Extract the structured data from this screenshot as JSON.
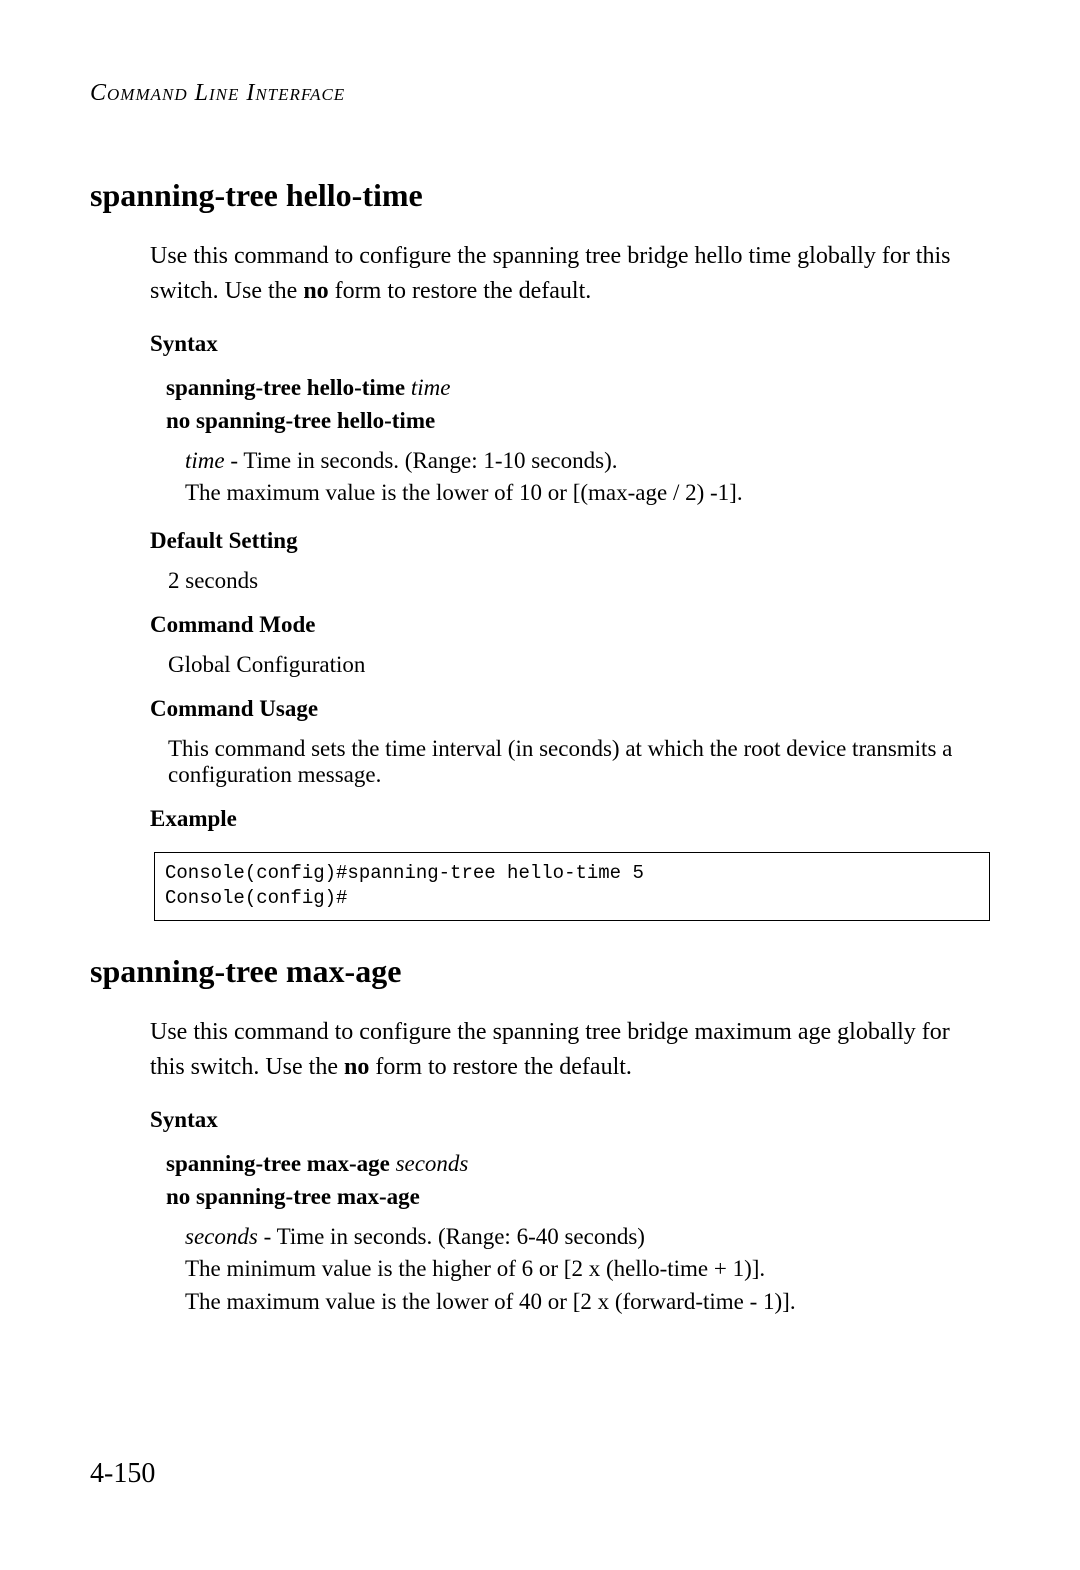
{
  "header": "Command Line Interface",
  "section1": {
    "title": "spanning-tree hello-time",
    "desc_pre": "Use this command to configure the spanning tree bridge hello time globally for this switch. Use the ",
    "desc_bold": "no",
    "desc_post": " form to restore the default.",
    "syntax_heading": "Syntax",
    "syntax_cmd": "spanning-tree hello-time",
    "syntax_param": "time",
    "syntax_no": "no spanning-tree hello-time",
    "param_name": "time",
    "param_desc": " - Time in seconds. (Range: 1-10 seconds).",
    "param_extra": "The maximum value is the lower of 10 or [(max-age / 2) -1].",
    "default_heading": "Default Setting",
    "default_value": "2 seconds",
    "mode_heading": "Command Mode",
    "mode_value": "Global Configuration",
    "usage_heading": "Command Usage",
    "usage_text": "This command sets the time interval (in seconds) at which the root device transmits a configuration message.",
    "example_heading": "Example",
    "example_code": "Console(config)#spanning-tree hello-time 5\nConsole(config)#"
  },
  "section2": {
    "title": "spanning-tree max-age",
    "desc_pre": "Use this command to configure the spanning tree bridge maximum age globally for this switch. Use the ",
    "desc_bold": "no",
    "desc_post": " form to restore the default.",
    "syntax_heading": "Syntax",
    "syntax_cmd": "spanning-tree max-age",
    "syntax_param": "seconds",
    "syntax_no": "no spanning-tree max-age",
    "param_name": "seconds",
    "param_desc": " - Time in seconds. (Range: 6-40 seconds)",
    "param_extra1": "The minimum value is the higher of 6 or [2 x (hello-time + 1)].",
    "param_extra2": "The maximum value is the lower of 40 or [2 x (forward-time - 1)]."
  },
  "page_number": "4-150"
}
